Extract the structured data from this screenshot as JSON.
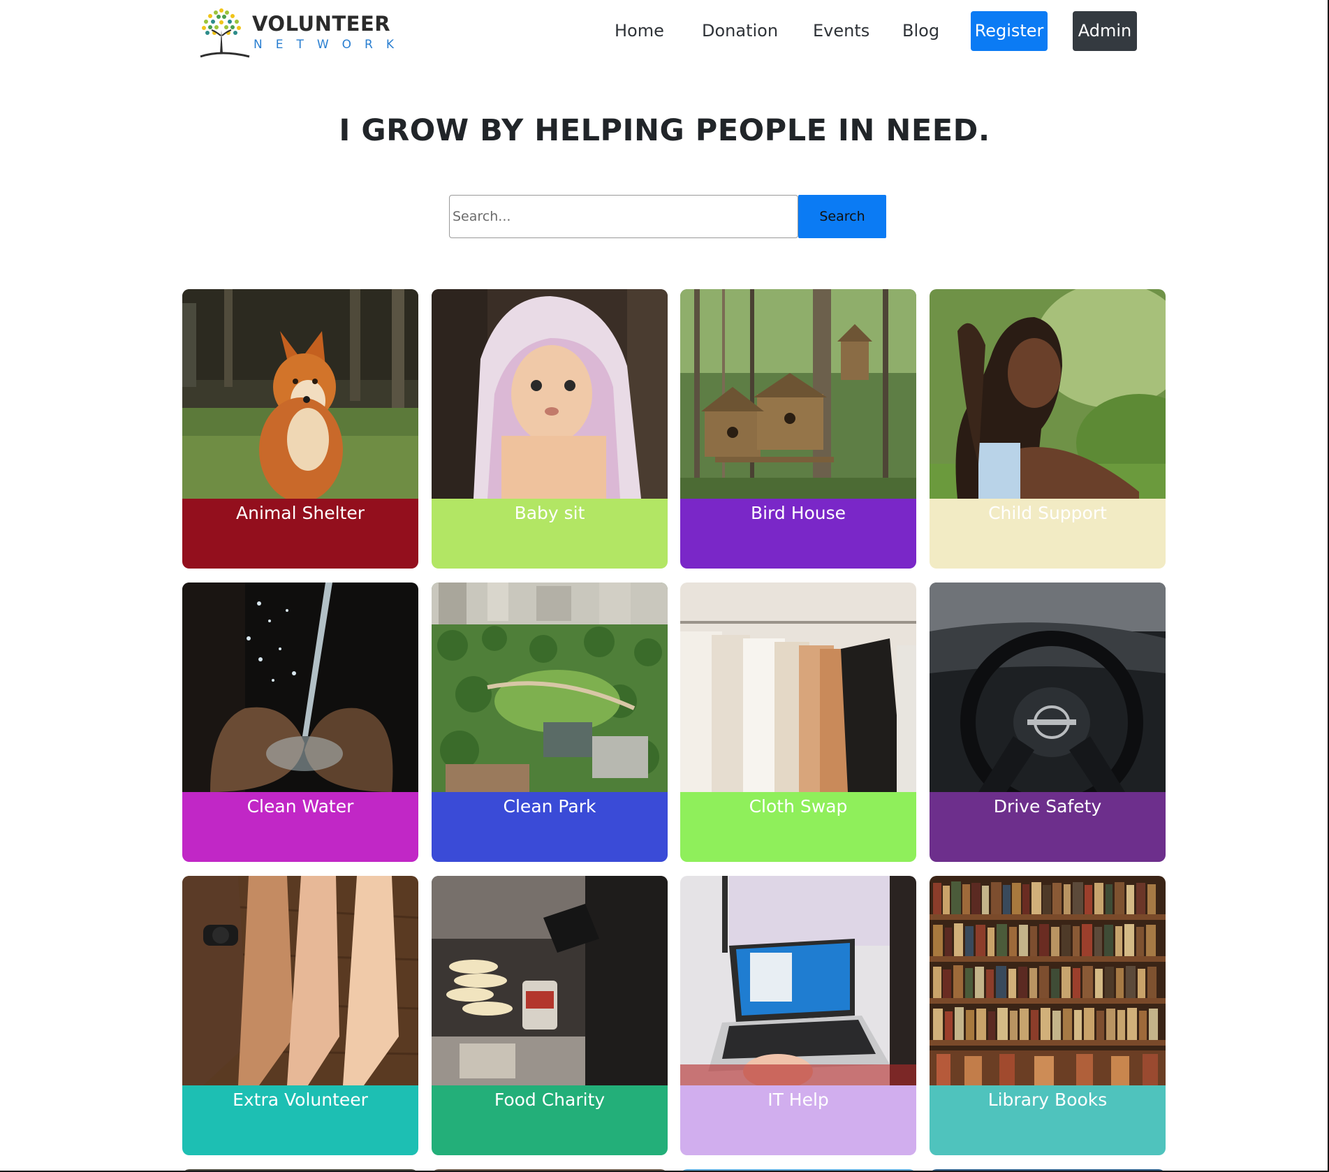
{
  "header": {
    "logo": {
      "word": "VOLUNTEER",
      "sub": "NETWORK"
    },
    "nav": {
      "home": "Home",
      "donation": "Donation",
      "events": "Events",
      "blog": "Blog",
      "register": "Register",
      "admin": "Admin"
    }
  },
  "hero": {
    "title": "I GROW BY HELPING PEOPLE IN NEED."
  },
  "search": {
    "placeholder": "Search...",
    "button_label": "Search"
  },
  "cards": [
    {
      "label": "Animal Shelter",
      "color": "#930f1d"
    },
    {
      "label": "Baby sit",
      "color": "#b2e664"
    },
    {
      "label": "Bird House",
      "color": "#7a27c8"
    },
    {
      "label": "Child Support",
      "color": "#f2ebc4"
    },
    {
      "label": "Clean Water",
      "color": "#c127c6"
    },
    {
      "label": "Clean Park",
      "color": "#3a4bd7"
    },
    {
      "label": "Cloth Swap",
      "color": "#8fef5b"
    },
    {
      "label": "Drive Safety",
      "color": "#6d2f8c"
    },
    {
      "label": "Extra Volunteer",
      "color": "#1dbfb3"
    },
    {
      "label": "Food Charity",
      "color": "#23af79"
    },
    {
      "label": "IT Help",
      "color": "#d1aeee"
    },
    {
      "label": "Library Books",
      "color": "#4fc3bd"
    }
  ],
  "colors": {
    "primary": "#0b7bf4",
    "dark": "#343a40"
  }
}
